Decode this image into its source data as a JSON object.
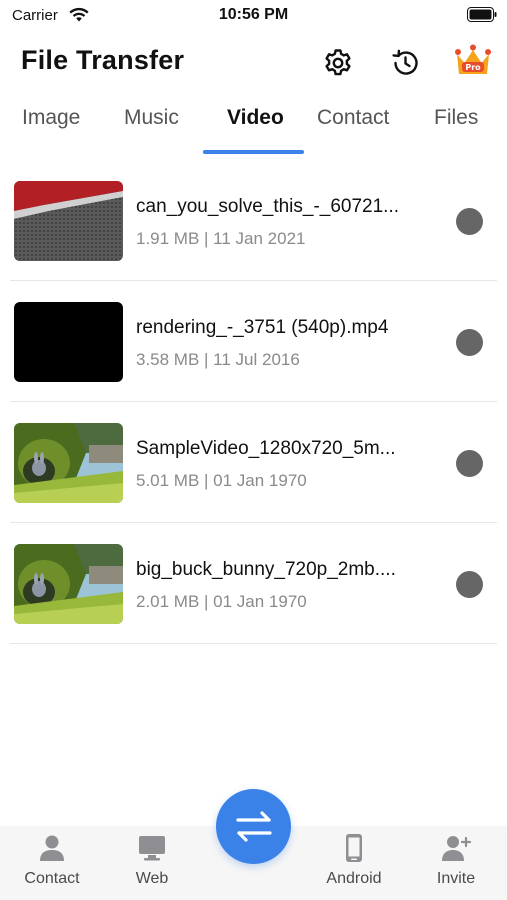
{
  "status_bar": {
    "carrier": "Carrier",
    "time": "10:56 PM"
  },
  "header": {
    "title": "File Transfer",
    "icons": [
      "gear-icon",
      "history-icon",
      "pro-crown-icon"
    ],
    "pro_badge": "Pro"
  },
  "tabs": [
    {
      "label": "Image",
      "active": false
    },
    {
      "label": "Music",
      "active": false
    },
    {
      "label": "Video",
      "active": true
    },
    {
      "label": "Contact",
      "active": false
    },
    {
      "label": "Files",
      "active": false
    }
  ],
  "files": [
    {
      "name": "can_you_solve_this_-_60721...",
      "meta": "1.91 MB | 11 Jan 2021",
      "thumb": "red-grey"
    },
    {
      "name": "rendering_-_3751 (540p).mp4",
      "meta": "3.58 MB | 11 Jul 2016",
      "thumb": "black"
    },
    {
      "name": "SampleVideo_1280x720_5m...",
      "meta": "5.01 MB | 01 Jan 1970",
      "thumb": "bunny"
    },
    {
      "name": "big_buck_bunny_720p_2mb....",
      "meta": "2.01 MB | 01 Jan 1970",
      "thumb": "bunny"
    }
  ],
  "bottom_nav": {
    "contact": "Contact",
    "web": "Web",
    "android": "Android",
    "invite": "Invite"
  },
  "colors": {
    "accent": "#3b82e8",
    "radio": "#666666",
    "meta_text": "#8a8a8a"
  }
}
